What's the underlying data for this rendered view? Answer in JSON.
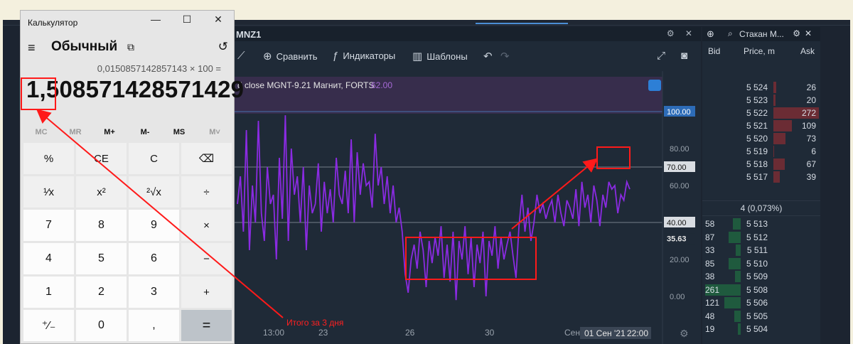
{
  "calculator": {
    "window_title": "Калькулятор",
    "controls": {
      "minimize": "—",
      "maximize": "☐",
      "close": "✕"
    },
    "mode": "Обычный",
    "mode_icon": "⧉",
    "history_icon": "↺",
    "menu_icon": "≡",
    "expression": "0,0150857142857143 × 100 =",
    "result": "1,508571428571429",
    "memory": [
      "MC",
      "MR",
      "M+",
      "M-",
      "MS",
      "M˅"
    ],
    "memory_enabled": [
      false,
      false,
      true,
      true,
      true,
      false
    ],
    "keys": [
      {
        "label": "%",
        "kind": "op",
        "name": "percent-key"
      },
      {
        "label": "CE",
        "kind": "op",
        "name": "clear-entry-key"
      },
      {
        "label": "C",
        "kind": "op",
        "name": "clear-key"
      },
      {
        "label": "⌫",
        "kind": "op",
        "name": "backspace-key"
      },
      {
        "label": "¹⁄x",
        "kind": "op",
        "name": "reciprocal-key"
      },
      {
        "label": "x²",
        "kind": "op",
        "name": "square-key"
      },
      {
        "label": "²√x",
        "kind": "op",
        "name": "sqrt-key"
      },
      {
        "label": "÷",
        "kind": "op",
        "name": "divide-key"
      },
      {
        "label": "7",
        "kind": "num",
        "name": "digit-7-key"
      },
      {
        "label": "8",
        "kind": "num",
        "name": "digit-8-key"
      },
      {
        "label": "9",
        "kind": "num",
        "name": "digit-9-key"
      },
      {
        "label": "×",
        "kind": "op",
        "name": "multiply-key"
      },
      {
        "label": "4",
        "kind": "num",
        "name": "digit-4-key"
      },
      {
        "label": "5",
        "kind": "num",
        "name": "digit-5-key"
      },
      {
        "label": "6",
        "kind": "num",
        "name": "digit-6-key"
      },
      {
        "label": "−",
        "kind": "op",
        "name": "minus-key"
      },
      {
        "label": "1",
        "kind": "num",
        "name": "digit-1-key"
      },
      {
        "label": "2",
        "kind": "num",
        "name": "digit-2-key"
      },
      {
        "label": "3",
        "kind": "num",
        "name": "digit-3-key"
      },
      {
        "label": "+",
        "kind": "op",
        "name": "plus-key"
      },
      {
        "label": "⁺⁄₋",
        "kind": "num",
        "name": "negate-key"
      },
      {
        "label": "0",
        "kind": "num",
        "name": "digit-0-key"
      },
      {
        "label": ",",
        "kind": "num",
        "name": "decimal-key"
      },
      {
        "label": "=",
        "kind": "eq",
        "name": "equals-key"
      }
    ]
  },
  "chart": {
    "symbol": "MNZ1",
    "header_icons": "⚙ ✕",
    "toolbar": {
      "compare": "Сравнить",
      "indicators": "Индикаторы",
      "templates": "Шаблоны"
    },
    "indicator_label": "d close MGNT-9.21 Магнит, FORTS",
    "indicator_value": "62.00",
    "x_labels": [
      "13:00",
      "23",
      "26",
      "30",
      "Сен"
    ],
    "x_highlight": "01 Сен '21",
    "x_time": "22:00",
    "levels": {
      "upper": "100.00",
      "overbought": "70.00",
      "oversold": "40.00",
      "current": "35.63"
    },
    "y_ticks": [
      "80.00",
      "60.00",
      "20.00",
      "0.00"
    ],
    "series_values": [
      50,
      65,
      35,
      90,
      25,
      60,
      40,
      95,
      45,
      30,
      70,
      50,
      55,
      20,
      75,
      42,
      98,
      30,
      80,
      55,
      65,
      40,
      70,
      25,
      60,
      45,
      50,
      72,
      35,
      62,
      45,
      58,
      40,
      75,
      55,
      50,
      68,
      45,
      85,
      40,
      78,
      55,
      72,
      60,
      62,
      48,
      88,
      60,
      70,
      50,
      65,
      45,
      60,
      40,
      48,
      35,
      12,
      2,
      20,
      28,
      15,
      35,
      25,
      5,
      30,
      18,
      32,
      22,
      38,
      10,
      28,
      8,
      35,
      -2,
      30,
      20,
      38,
      12,
      32,
      5,
      28,
      18,
      35,
      0,
      30,
      22,
      38,
      15,
      32,
      20,
      28,
      35,
      22,
      10,
      38,
      55,
      35,
      48,
      30,
      40,
      55,
      45,
      50,
      42,
      48,
      52,
      40,
      55,
      45,
      38,
      52,
      48,
      42,
      58,
      38,
      62,
      48,
      55,
      40,
      60,
      52,
      38,
      55,
      48,
      62,
      58,
      60,
      45,
      55,
      52,
      62,
      58
    ],
    "annotation_note": "Итого за 3 дня"
  },
  "order_book": {
    "title": "Стакан M...",
    "columns": {
      "bid": "Bid",
      "price": "Price, m",
      "ask": "Ask"
    },
    "asks": [
      {
        "price": "5 524",
        "ask": "26",
        "fill": 0.06
      },
      {
        "price": "5 523",
        "ask": "20",
        "fill": 0.05
      },
      {
        "price": "5 522",
        "ask": "272",
        "fill": 1.0
      },
      {
        "price": "5 521",
        "ask": "109",
        "fill": 0.4
      },
      {
        "price": "5 520",
        "ask": "73",
        "fill": 0.27
      },
      {
        "price": "5 519",
        "ask": "6",
        "fill": 0.02
      },
      {
        "price": "5 518",
        "ask": "67",
        "fill": 0.25
      },
      {
        "price": "5 517",
        "ask": "39",
        "fill": 0.14
      }
    ],
    "spread": "4 (0,073%)",
    "bids": [
      {
        "bid": "58",
        "price": "5 513",
        "fill": 0.22
      },
      {
        "bid": "87",
        "price": "5 512",
        "fill": 0.33
      },
      {
        "bid": "33",
        "price": "5 511",
        "fill": 0.13
      },
      {
        "bid": "85",
        "price": "5 510",
        "fill": 0.33
      },
      {
        "bid": "38",
        "price": "5 509",
        "fill": 0.15
      },
      {
        "bid": "261",
        "price": "5 508",
        "fill": 1.0
      },
      {
        "bid": "121",
        "price": "5 506",
        "fill": 0.46
      },
      {
        "bid": "48",
        "price": "5 505",
        "fill": 0.18
      },
      {
        "bid": "19",
        "price": "5 504",
        "fill": 0.07
      }
    ]
  },
  "colors": {
    "series": "#8a2be2",
    "annotation": "#ff1a1a",
    "ask_bar": "#6b2c34",
    "bid_bar": "#1f5a3e",
    "upper_band": "#4a2f5e"
  }
}
